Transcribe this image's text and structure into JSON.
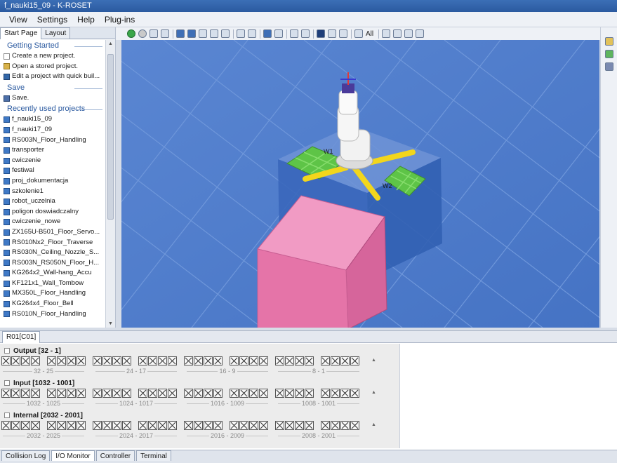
{
  "window": {
    "title": "f_nauki15_09 - K-ROSET"
  },
  "menu": [
    "View",
    "Settings",
    "Help",
    "Plug-ins"
  ],
  "left_panel": {
    "tabs": [
      {
        "label": "Start Page",
        "active": true
      },
      {
        "label": "Layout",
        "active": false
      }
    ],
    "getting_started": {
      "title": "Getting Started",
      "items": [
        {
          "label": "Create a new project.",
          "icon": "new-file-icon"
        },
        {
          "label": "Open a stored project.",
          "icon": "open-folder-icon"
        },
        {
          "label": "Edit a project with quick buil...",
          "icon": "wand-icon"
        }
      ]
    },
    "save": {
      "title": "Save",
      "items": [
        {
          "label": "Save.",
          "icon": "save-icon"
        }
      ]
    },
    "recent": {
      "title": "Recently used projects",
      "items": [
        "f_nauki15_09",
        "f_nauki17_09",
        "RS003N_Floor_Handling",
        "transporter",
        "cwiczenie",
        "festiwal",
        "proj_dokumentacja",
        "szkolenie1",
        "robot_uczelnia",
        "poligon doswiadczalny",
        "cwiczenie_nowe",
        "ZX165U-B501_Floor_Servo...",
        "RS010Nx2_Floor_Traverse",
        "RS030N_Ceiling_Nozzle_S...",
        "RS003N_RS050N_Floor_H...",
        "KG264x2_Wall-hang_Accu",
        "KF121x1_Wall_Tombow",
        "MX350L_Floor_Handling",
        "KG264x4_Floor_Bell",
        "RS010N_Floor_Handling"
      ]
    }
  },
  "toolbar": {
    "all_label": "All"
  },
  "viewport": {
    "labels": [
      "W1",
      "W2"
    ],
    "colors": {
      "floor": "#4b7bcc",
      "box": "#e574a8",
      "pedestal": "#3d6fc4",
      "pallet": "#5ec447",
      "arm": "#f2d61c",
      "robot": "#f1f1f1"
    }
  },
  "bottom_panel": {
    "tab": "R01[C01]",
    "groups": [
      {
        "title": "Output [32 - 1]",
        "ranges": [
          "32 - 25",
          "24 - 17",
          "16 - 9",
          "8 - 1"
        ]
      },
      {
        "title": "Input [1032 - 1001]",
        "ranges": [
          "1032 - 1025",
          "1024 - 1017",
          "1016 - 1009",
          "1008 - 1001"
        ]
      },
      {
        "title": "Internal [2032 - 2001]",
        "ranges": [
          "2032 - 2025",
          "2024 - 2017",
          "2016 - 2009",
          "2008 - 2001"
        ]
      }
    ]
  },
  "status_tabs": [
    {
      "label": "Collision Log",
      "active": false
    },
    {
      "label": "I/O Monitor",
      "active": true
    },
    {
      "label": "Controller",
      "active": false
    },
    {
      "label": "Terminal",
      "active": false
    }
  ]
}
